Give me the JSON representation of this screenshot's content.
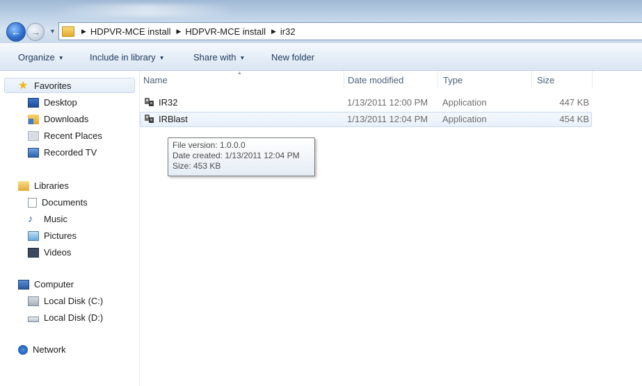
{
  "breadcrumb": [
    "HDPVR-MCE install",
    "HDPVR-MCE install",
    "ir32"
  ],
  "toolbar": {
    "organize": "Organize",
    "include_in_library": "Include in library",
    "share_with": "Share with",
    "new_folder": "New folder"
  },
  "nav": {
    "favorites": "Favorites",
    "desktop": "Desktop",
    "downloads": "Downloads",
    "recent_places": "Recent Places",
    "recorded_tv": "Recorded TV",
    "libraries": "Libraries",
    "documents": "Documents",
    "music": "Music",
    "pictures": "Pictures",
    "videos": "Videos",
    "computer": "Computer",
    "local_disk_c": "Local Disk (C:)",
    "local_disk_d": "Local Disk (D:)",
    "network": "Network"
  },
  "columns": {
    "name": "Name",
    "date_modified": "Date modified",
    "type": "Type",
    "size": "Size"
  },
  "files": [
    {
      "name": "IR32",
      "date_modified": "1/13/2011 12:00 PM",
      "type": "Application",
      "size": "447 KB"
    },
    {
      "name": "IRBlast",
      "date_modified": "1/13/2011 12:04 PM",
      "type": "Application",
      "size": "454 KB"
    }
  ],
  "tooltip": {
    "file_version": "File version: 1.0.0.0",
    "date_created": "Date created: 1/13/2011 12:04 PM",
    "size": "Size: 453 KB"
  },
  "colors": {
    "selection": "#e8f0fa",
    "accent": "#1e395b"
  }
}
